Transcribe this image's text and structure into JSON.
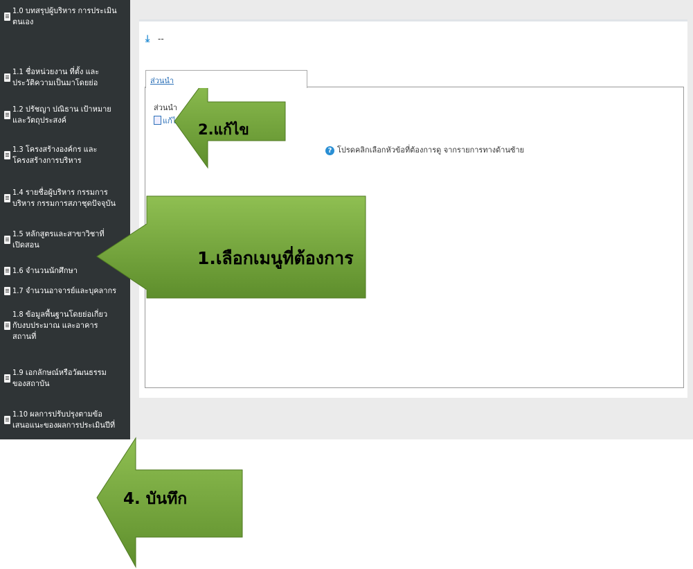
{
  "sidebar": {
    "items": [
      {
        "label": "1.0 บทสรุปผู้บริหาร การประเมินตนเอง"
      },
      {
        "label": "1.1 ชื่อหน่วยงาน ที่ตั้ง และประวัติความเป็นมาโดยย่อ"
      },
      {
        "label": "1.2 ปรัชญา ปณิธาน เป้าหมายและวัตถุประสงค์"
      },
      {
        "label": "1.3 โครงสร้างองค์กร และโครงสร้างการบริหาร"
      },
      {
        "label": "1.4 รายชื่อผู้บริหาร กรรมการบริหาร กรรมการสภาชุดปัจจุบัน"
      },
      {
        "label": "1.5 หลักสูตรและสาขาวิชาที่เปิดสอน"
      },
      {
        "label": "1.6 จำนวนนักศึกษา"
      },
      {
        "label": "1.7 จำนวนอาจารย์และบุคลากร"
      },
      {
        "label": "1.8 ข้อมูลพื้นฐานโดยย่อเกี่ยวกับงบประมาณ และอาคารสถานที่"
      },
      {
        "label": "1.9 เอกลักษณ์หรือวัฒนธรรมของสถาบัน"
      },
      {
        "label": "1.10 ผลการปรับปรุงตามข้อเสนอแนะของผลการประเมินปีที่"
      }
    ]
  },
  "header": {
    "download_text": "--"
  },
  "tab": {
    "label": "ส่วนนำ"
  },
  "content": {
    "section_title": "ส่วนนำ",
    "edit_label": "แก้ไข",
    "help_text": "โปรดคลิกเลือกหัวข้อที่ต้องการดู จากรายการทางด้านซ้าย"
  },
  "annotations": {
    "step1": "1.เลือกเมนูที่ต้องการ",
    "step2": "2.แก้ไข",
    "step4": "4. บันทึก"
  },
  "colors": {
    "sidebar_bg": "#2f3436",
    "arrow_green": "#76a839",
    "link_blue": "#2a6fb7"
  }
}
